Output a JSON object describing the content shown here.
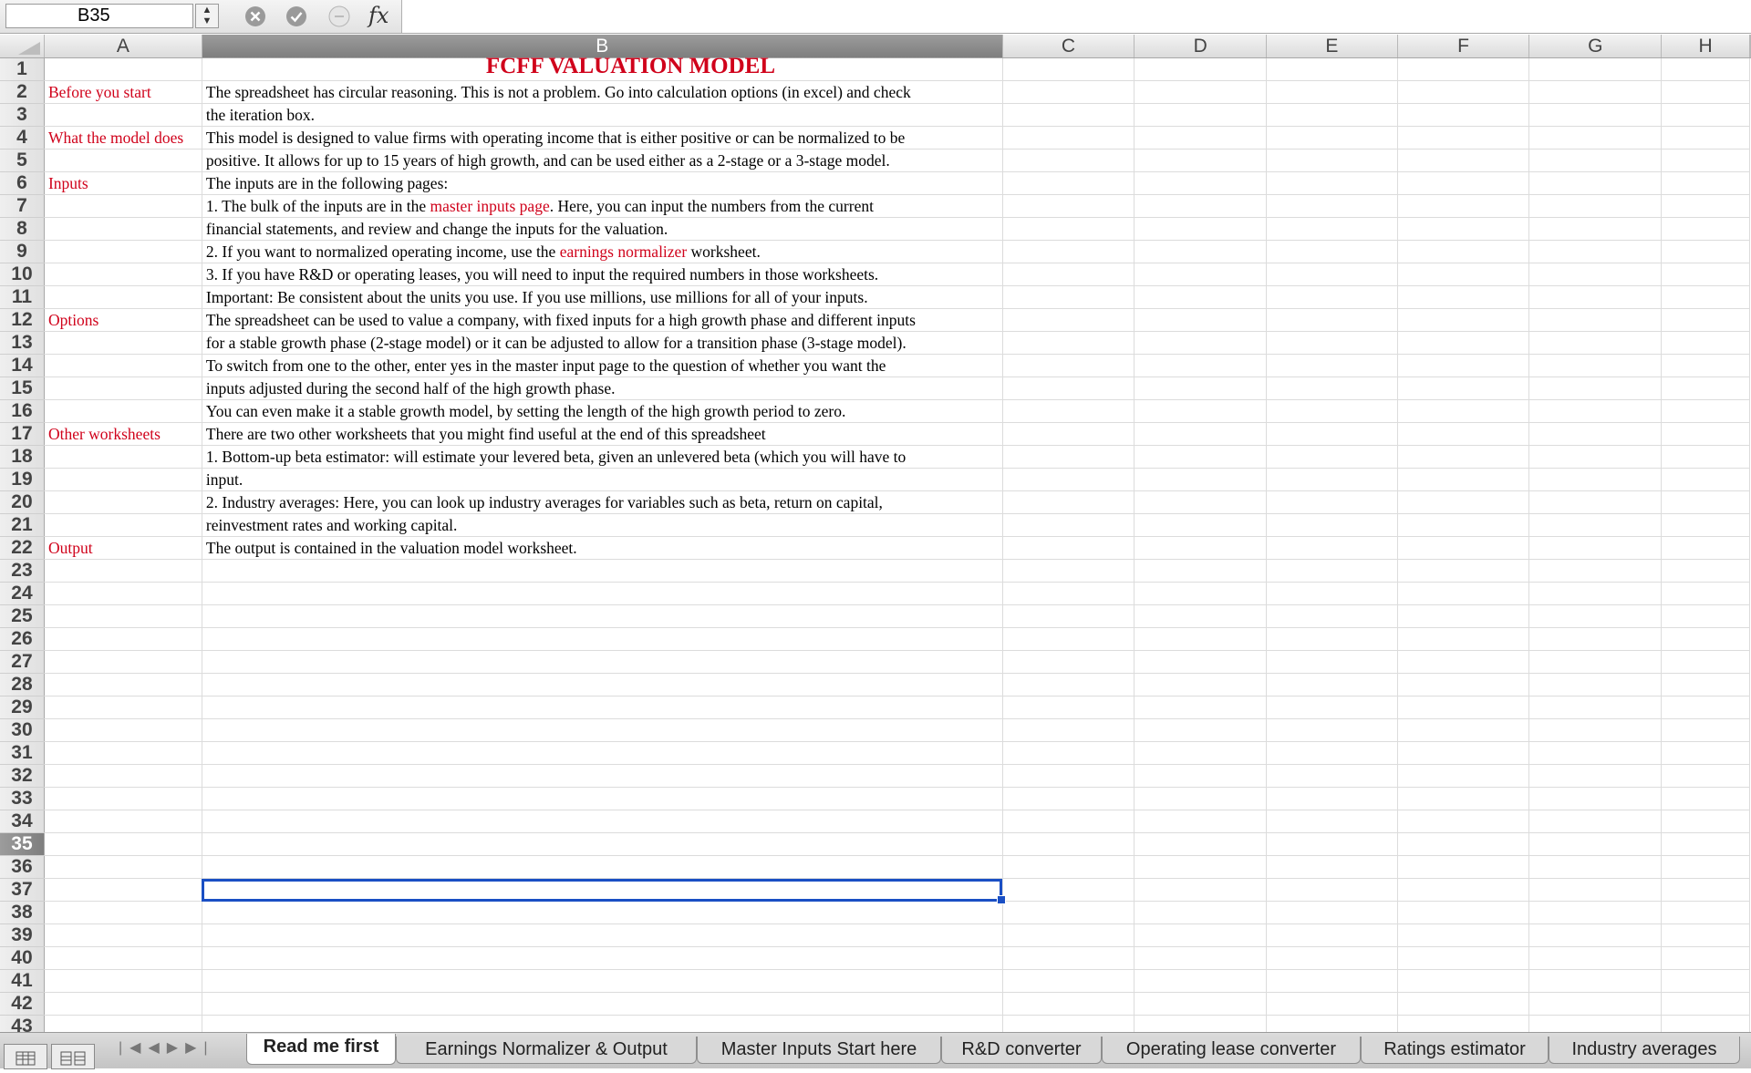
{
  "formula_bar": {
    "name_box": "B35",
    "fx_label": "fx",
    "formula": ""
  },
  "columns": [
    "A",
    "B",
    "C",
    "D",
    "E",
    "F",
    "G",
    "H"
  ],
  "title": "FCFF VALUATION MODEL",
  "rows": [
    {
      "num": "1",
      "a": "",
      "b": ""
    },
    {
      "num": "2",
      "a": "Before you start",
      "b": "The spreadsheet has circular reasoning. This is not a problem. Go into calculation options (in excel) and check"
    },
    {
      "num": "3",
      "a": "",
      "b": "the iteration box."
    },
    {
      "num": "4",
      "a": "What the model does",
      "b": "This model is designed to value firms with operating income that is either positive or can be normalized to be"
    },
    {
      "num": "5",
      "a": "",
      "b": "positive. It allows for up to 15 years of high growth, and can be used either as a 2-stage or a 3-stage model."
    },
    {
      "num": "6",
      "a": "Inputs",
      "b": "The inputs are in the following pages:"
    },
    {
      "num": "7",
      "a": "",
      "b_pre": "1. The bulk of the inputs are in the ",
      "b_red": "master inputs page",
      "b_post": ". Here, you can input the numbers from the current"
    },
    {
      "num": "8",
      "a": "",
      "b": "financial statements, and review and change the inputs for the valuation."
    },
    {
      "num": "9",
      "a": "",
      "b_pre": "2. If you want to normalized operating income, use the ",
      "b_red": "earnings normalizer",
      "b_post": " worksheet."
    },
    {
      "num": "10",
      "a": "",
      "b": "3. If you have R&D or operating leases, you will need to input the required numbers in those worksheets."
    },
    {
      "num": "11",
      "a": "",
      "b": "Important: Be consistent about the units you use. If you use millions, use millions for all of your inputs."
    },
    {
      "num": "12",
      "a": "Options",
      "b": "The spreadsheet can be used to value a company, with fixed inputs for a high growth phase and different inputs"
    },
    {
      "num": "13",
      "a": "",
      "b": "for a stable growth phase (2-stage model) or it can be adjusted to allow for a transition phase (3-stage model)."
    },
    {
      "num": "14",
      "a": "",
      "b": "To switch from one to the other, enter yes in the master input page to the question of whether you want the"
    },
    {
      "num": "15",
      "a": "",
      "b": "inputs adjusted during the second half of the high growth phase."
    },
    {
      "num": "16",
      "a": "",
      "b": "You can even make it a stable growth model, by setting the length of the high growth period to zero."
    },
    {
      "num": "17",
      "a": "Other worksheets",
      "b": "There are two other worksheets that you might find useful at the end of this spreadsheet"
    },
    {
      "num": "18",
      "a": "",
      "b": "1. Bottom-up beta estimator: will estimate your levered beta, given an unlevered beta (which you will have to"
    },
    {
      "num": "19",
      "a": "",
      "b": "input."
    },
    {
      "num": "20",
      "a": "",
      "b": "2. Industry averages: Here, you can look up industry averages for variables such as beta, return on capital,"
    },
    {
      "num": "21",
      "a": "",
      "b": "reinvestment rates and working capital."
    },
    {
      "num": "22",
      "a": "Output",
      "b": "The output is contained in the valuation model worksheet."
    },
    {
      "num": "23",
      "a": "",
      "b": ""
    },
    {
      "num": "24",
      "a": "",
      "b": ""
    },
    {
      "num": "25",
      "a": "",
      "b": ""
    },
    {
      "num": "26",
      "a": "",
      "b": ""
    },
    {
      "num": "27",
      "a": "",
      "b": ""
    },
    {
      "num": "28",
      "a": "",
      "b": ""
    },
    {
      "num": "29",
      "a": "",
      "b": ""
    },
    {
      "num": "30",
      "a": "",
      "b": ""
    },
    {
      "num": "31",
      "a": "",
      "b": ""
    },
    {
      "num": "32",
      "a": "",
      "b": ""
    },
    {
      "num": "33",
      "a": "",
      "b": ""
    },
    {
      "num": "34",
      "a": "",
      "b": ""
    },
    {
      "num": "35",
      "a": "",
      "b": ""
    },
    {
      "num": "36",
      "a": "",
      "b": ""
    },
    {
      "num": "37",
      "a": "",
      "b": ""
    },
    {
      "num": "38",
      "a": "",
      "b": ""
    },
    {
      "num": "39",
      "a": "",
      "b": ""
    },
    {
      "num": "40",
      "a": "",
      "b": ""
    },
    {
      "num": "41",
      "a": "",
      "b": ""
    },
    {
      "num": "42",
      "a": "",
      "b": ""
    },
    {
      "num": "43",
      "a": "",
      "b": ""
    }
  ],
  "selected": {
    "row": "35",
    "column": "B"
  },
  "sheet_tabs": [
    {
      "label": "Read me first",
      "active": true
    },
    {
      "label": "Earnings Normalizer & Output",
      "active": false
    },
    {
      "label": "Master Inputs Start here",
      "active": false
    },
    {
      "label": "R&D converter",
      "active": false
    },
    {
      "label": "Operating lease converter",
      "active": false
    },
    {
      "label": "Ratings estimator",
      "active": false
    },
    {
      "label": "Industry averages",
      "active": false
    }
  ],
  "colors": {
    "label_red": "#d0021b",
    "selection_blue": "#1a4fc4"
  },
  "icons": [
    "cancel-icon",
    "confirm-icon",
    "function-icon",
    "normal-view-icon",
    "page-layout-view-icon"
  ]
}
